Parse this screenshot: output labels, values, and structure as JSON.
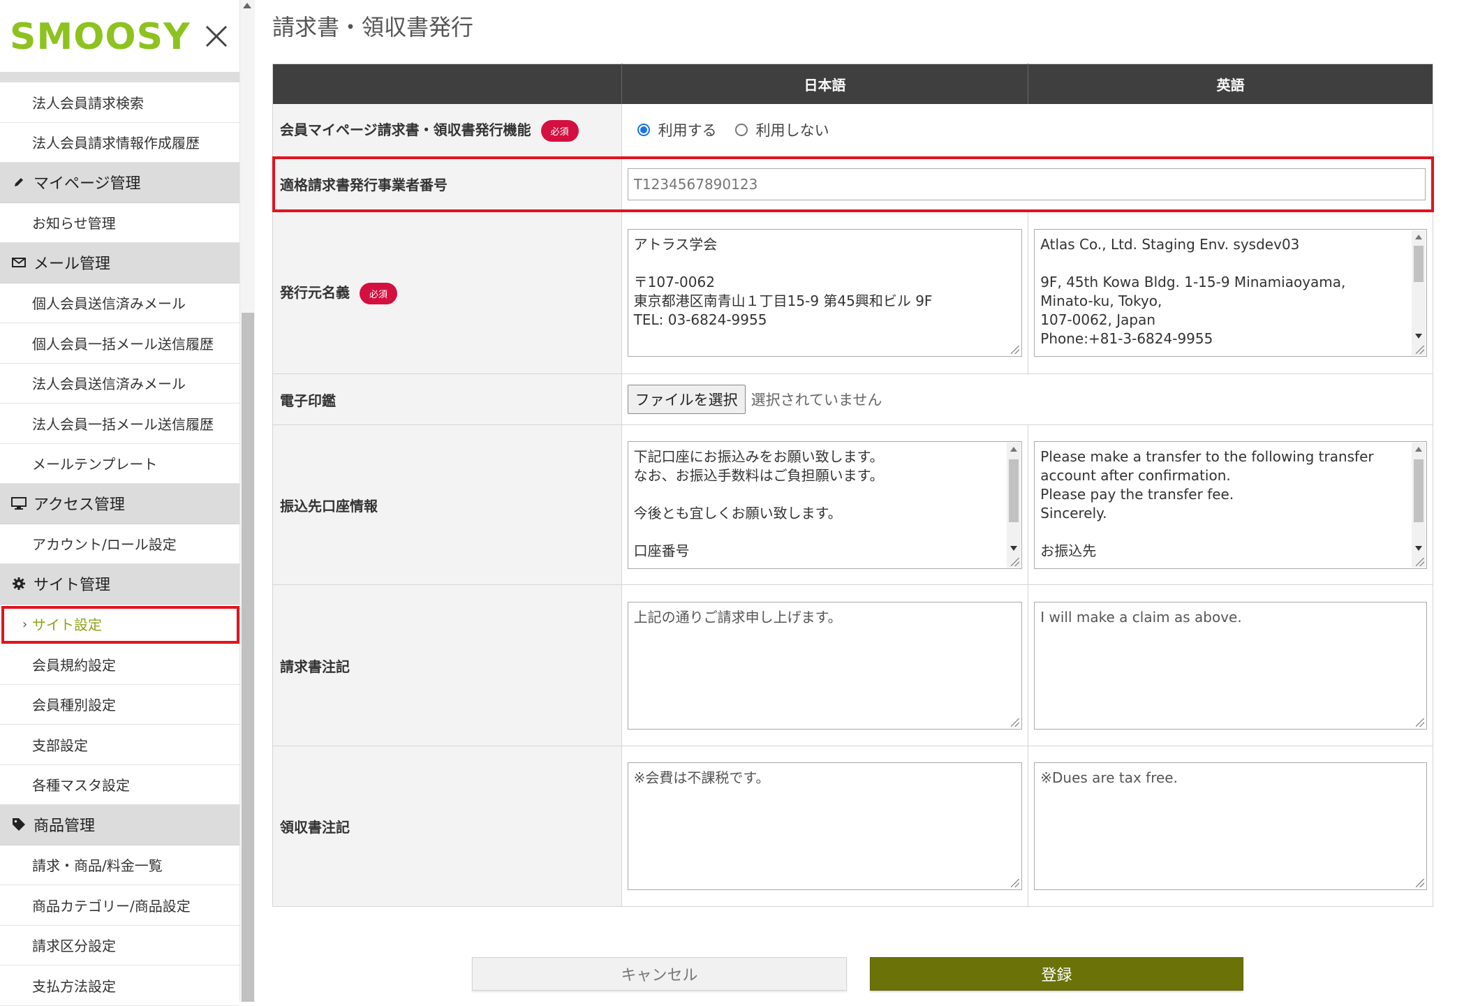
{
  "sidebar": {
    "logo_text": "SMOOSY",
    "menu": [
      {
        "type": "item",
        "label": "法人会員請求検索"
      },
      {
        "type": "item",
        "label": "法人会員請求情報作成履歴"
      },
      {
        "type": "section",
        "label": "マイページ管理",
        "icon": "pen-icon"
      },
      {
        "type": "item",
        "label": "お知らせ管理"
      },
      {
        "type": "section",
        "label": "メール管理",
        "icon": "envelope-icon"
      },
      {
        "type": "item",
        "label": "個人会員送信済みメール"
      },
      {
        "type": "item",
        "label": "個人会員一括メール送信履歴"
      },
      {
        "type": "item",
        "label": "法人会員送信済みメール"
      },
      {
        "type": "item",
        "label": "法人会員一括メール送信履歴"
      },
      {
        "type": "item",
        "label": "メールテンプレート"
      },
      {
        "type": "section",
        "label": "アクセス管理",
        "icon": "monitor-icon"
      },
      {
        "type": "item",
        "label": "アカウント/ロール設定"
      },
      {
        "type": "section",
        "label": "サイト管理",
        "icon": "gear-icon"
      },
      {
        "type": "item",
        "label": "サイト設定",
        "active": true
      },
      {
        "type": "item",
        "label": "会員規約設定"
      },
      {
        "type": "item",
        "label": "会員種別設定"
      },
      {
        "type": "item",
        "label": "支部設定"
      },
      {
        "type": "item",
        "label": "各種マスタ設定"
      },
      {
        "type": "section",
        "label": "商品管理",
        "icon": "tag-icon"
      },
      {
        "type": "item",
        "label": "請求・商品/料金一覧"
      },
      {
        "type": "item",
        "label": "商品カテゴリー/商品設定"
      },
      {
        "type": "item",
        "label": "請求区分設定"
      },
      {
        "type": "item",
        "label": "支払方法設定"
      }
    ]
  },
  "page": {
    "title": "請求書・領収書発行",
    "columns": {
      "ja": "日本語",
      "en": "英語"
    },
    "required_badge": "必須",
    "rows": {
      "feature": {
        "label": "会員マイページ請求書・領収書発行機能",
        "option_use": "利用する",
        "option_nouse": "利用しない",
        "selected": "利用する"
      },
      "registration_number": {
        "label": "適格請求書発行事業者番号",
        "placeholder": "T1234567890123"
      },
      "issuer_name": {
        "label": "発行元名義",
        "ja": "アトラス学会\n\n〒107-0062\n東京都港区南青山１丁目15-9 第45興和ビル 9F\nTEL: 03-6824-9955",
        "en": "Atlas Co., Ltd. Staging Env. sysdev03\n\n9F, 45th Kowa Bldg. 1-15-9 Minamiaoyama,\nMinato-ku, Tokyo,\n107-0062, Japan\nPhone:+81-3-6824-9955"
      },
      "seal": {
        "label": "電子印鑑",
        "button": "ファイルを選択",
        "status": "選択されていません"
      },
      "bank_info": {
        "label": "振込先口座情報",
        "ja": "下記口座にお振込みをお願い致します。\nなお、お振込手数料はご負担願います。\n\n今後とも宜しくお願い致します。\n\n口座番号",
        "en": "Please make a transfer to the following transfer\naccount after confirmation.\nPlease pay the transfer fee.\nSincerely.\n\nお振込先"
      },
      "invoice_note": {
        "label": "請求書注記",
        "ja": "上記の通りご請求申し上げます。",
        "en": "I will make a claim as above."
      },
      "receipt_note": {
        "label": "領収書注記",
        "ja": "※会費は不課税です。",
        "en": "※Dues are tax free."
      }
    },
    "buttons": {
      "cancel": "キャンセル",
      "submit": "登録"
    }
  },
  "colors": {
    "brand_green": "#8dc21f",
    "submit": "#6b7308",
    "required": "#d3103f",
    "highlight": "#e0141e"
  }
}
